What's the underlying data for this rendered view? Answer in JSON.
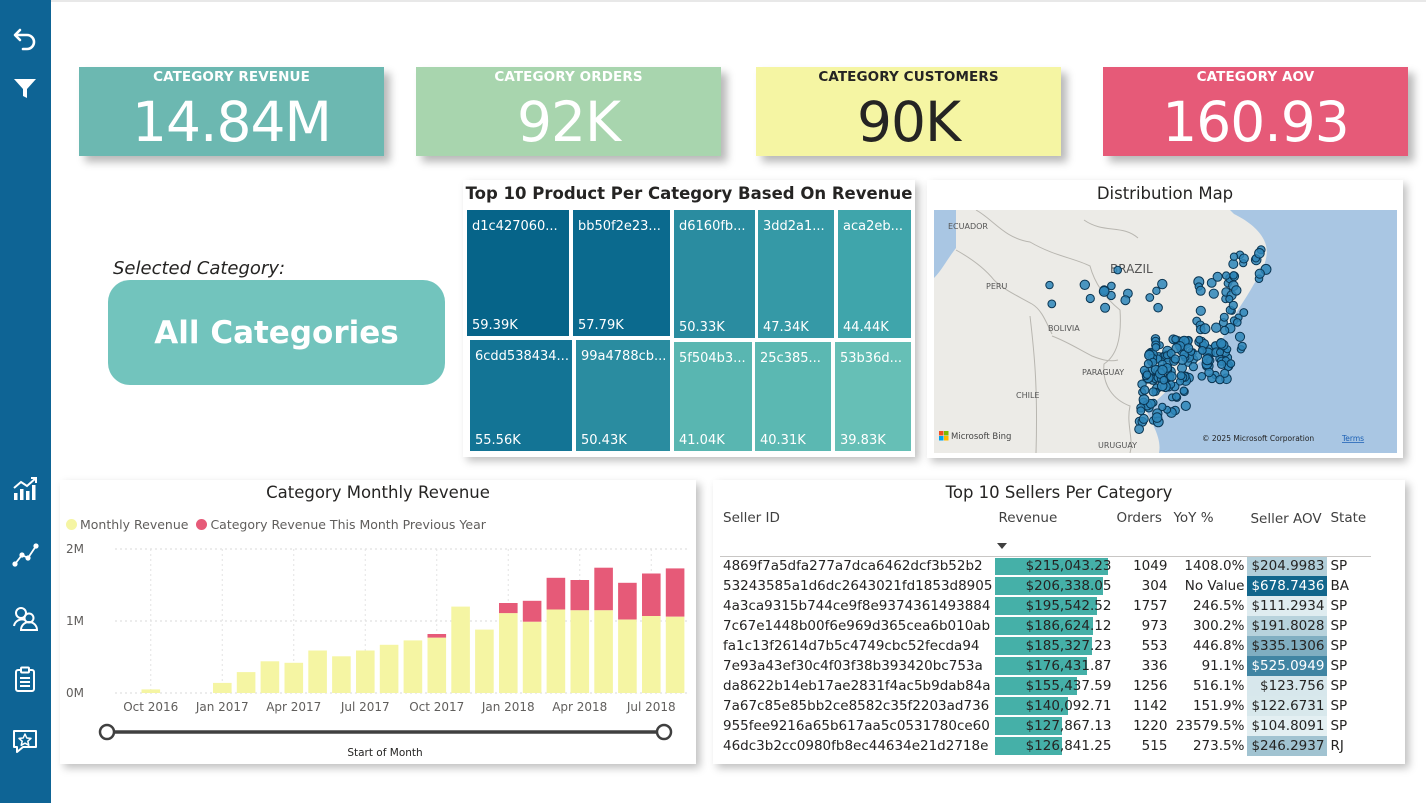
{
  "sidebar": {
    "items": [
      {
        "icon": "back-arrow-icon"
      },
      {
        "icon": "filter-icon"
      },
      {
        "icon": "bar-chart-icon"
      },
      {
        "icon": "line-chart-icon"
      },
      {
        "icon": "people-icon"
      },
      {
        "icon": "clipboard-icon"
      },
      {
        "icon": "review-star-icon"
      }
    ]
  },
  "kpis": [
    {
      "title": "CATEGORY REVENUE",
      "value": "14.84M",
      "bg": "#6cb8b1",
      "fg": "#ffffff"
    },
    {
      "title": "CATEGORY ORDERS",
      "value": "92K",
      "bg": "#a8d5ae",
      "fg": "#ffffff"
    },
    {
      "title": "CATEGORY CUSTOMERS",
      "value": "90K",
      "bg": "#f5f5a3",
      "fg": "#252423"
    },
    {
      "title": "CATEGORY AOV",
      "value": "160.93",
      "bg": "#e65a78",
      "fg": "#ffffff"
    }
  ],
  "selection": {
    "label": "Selected Category:",
    "value": "All Categories"
  },
  "treemap": {
    "title": "Top 10 Product Per Category Based On Revenue",
    "tiles": [
      {
        "name": "d1c427060...",
        "value": "59.39K",
        "color": "#066489"
      },
      {
        "name": "bb50f2e23...",
        "value": "57.79K",
        "color": "#0b6a8e"
      },
      {
        "name": "6cdd538434...",
        "value": "55.56K",
        "color": "#137495"
      },
      {
        "name": "99a4788cb...",
        "value": "50.43K",
        "color": "#2a8ca0"
      },
      {
        "name": "d6160fb...",
        "value": "50.33K",
        "color": "#2a8ca0"
      },
      {
        "name": "3dd2a1...",
        "value": "47.34K",
        "color": "#3599a6"
      },
      {
        "name": "aca2eb...",
        "value": "44.44K",
        "color": "#3fa5ab"
      },
      {
        "name": "5f504b3...",
        "value": "41.04K",
        "color": "#59b6b1"
      },
      {
        "name": "25c385...",
        "value": "40.31K",
        "color": "#5bb8b2"
      },
      {
        "name": "53b36d...",
        "value": "39.83K",
        "color": "#66bfb6"
      }
    ]
  },
  "map": {
    "title": "Distribution Map",
    "labels": {
      "ecuador": "ECUADOR",
      "brazil": "BRAZIL",
      "peru": "PERU",
      "bolivia": "BOLIVIA",
      "paraguay": "PARAGUAY",
      "chile": "CHILE",
      "uruguay": "URUGUAY"
    },
    "provider": "Microsoft Bing",
    "copyright": "© 2025 Microsoft Corporation",
    "terms": "Terms"
  },
  "monthly_chart": {
    "title": "Category Monthly Revenue",
    "legend": [
      {
        "name": "Monthly Revenue",
        "color": "#f5f5a3"
      },
      {
        "name": "Category Revenue This Month Previous Year",
        "color": "#e65a78"
      }
    ],
    "slider_label": "Start of Month"
  },
  "chart_data": {
    "type": "bar",
    "title": "Category Monthly Revenue",
    "xlabel": "",
    "ylabel": "",
    "ylim": [
      0,
      2000000
    ],
    "y_ticks": [
      "0M",
      "1M",
      "2M"
    ],
    "x_ticks": [
      "Oct 2016",
      "Jan 2017",
      "Apr 2017",
      "Jul 2017",
      "Oct 2017",
      "Jan 2018",
      "Apr 2018",
      "Jul 2018"
    ],
    "categories": [
      "Sep 2016",
      "Oct 2016",
      "Nov 2016",
      "Dec 2016",
      "Jan 2017",
      "Feb 2017",
      "Mar 2017",
      "Apr 2017",
      "May 2017",
      "Jun 2017",
      "Jul 2017",
      "Aug 2017",
      "Sep 2017",
      "Oct 2017",
      "Nov 2017",
      "Dec 2017",
      "Jan 2018",
      "Feb 2018",
      "Mar 2018",
      "Apr 2018",
      "May 2018",
      "Jun 2018",
      "Jul 2018",
      "Aug 2018"
    ],
    "series": [
      {
        "name": "Monthly Revenue",
        "values": [
          0,
          50000,
          0,
          0,
          140000,
          290000,
          440000,
          420000,
          590000,
          510000,
          590000,
          670000,
          730000,
          770000,
          1200000,
          880000,
          1110000,
          990000,
          1160000,
          1150000,
          1150000,
          1020000,
          1070000,
          1060000
        ]
      },
      {
        "name": "Category Revenue This Month Previous Year",
        "values": [
          0,
          0,
          0,
          0,
          0,
          0,
          0,
          0,
          0,
          0,
          0,
          0,
          0,
          50000,
          0,
          0,
          140000,
          290000,
          440000,
          420000,
          590000,
          510000,
          590000,
          670000
        ]
      }
    ]
  },
  "sellers_table": {
    "title": "Top 10 Sellers Per Category",
    "headers": {
      "seller": "Seller ID",
      "revenue": "Revenue",
      "orders": "Orders",
      "yoy": "YoY %",
      "aov": "Seller AOV",
      "state": "State"
    },
    "revenue_max": 215043.23,
    "aov_max": 678.7436,
    "rows": [
      {
        "seller": "4869f7a5dfa277a7dca6462dcf3b52b2",
        "revenue": "$215,043.23",
        "rev_num": 215043.23,
        "orders": "1049",
        "yoy": "1408.0%",
        "aov": "$204.9983",
        "aov_num": 204.9983,
        "state": "SP"
      },
      {
        "seller": "53243585a1d6dc2643021fd1853d8905",
        "revenue": "$206,338.05",
        "rev_num": 206338.05,
        "orders": "304",
        "yoy": "No Value",
        "aov": "$678.7436",
        "aov_num": 678.7436,
        "state": "BA"
      },
      {
        "seller": "4a3ca9315b744ce9f8e9374361493884",
        "revenue": "$195,542.52",
        "rev_num": 195542.52,
        "orders": "1757",
        "yoy": "246.5%",
        "aov": "$111.2934",
        "aov_num": 111.2934,
        "state": "SP"
      },
      {
        "seller": "7c67e1448b00f6e969d365cea6b010ab",
        "revenue": "$186,624.12",
        "rev_num": 186624.12,
        "orders": "973",
        "yoy": "300.2%",
        "aov": "$191.8028",
        "aov_num": 191.8028,
        "state": "SP"
      },
      {
        "seller": "fa1c13f2614d7b5c4749cbc52fecda94",
        "revenue": "$185,327.23",
        "rev_num": 185327.23,
        "orders": "553",
        "yoy": "446.8%",
        "aov": "$335.1306",
        "aov_num": 335.1306,
        "state": "SP"
      },
      {
        "seller": "7e93a43ef30c4f03f38b393420bc753a",
        "revenue": "$176,431.87",
        "rev_num": 176431.87,
        "orders": "336",
        "yoy": "91.1%",
        "aov": "$525.0949",
        "aov_num": 525.0949,
        "state": "SP"
      },
      {
        "seller": "da8622b14eb17ae2831f4ac5b9dab84a",
        "revenue": "$155,437.59",
        "rev_num": 155437.59,
        "orders": "1256",
        "yoy": "516.1%",
        "aov": "$123.756",
        "aov_num": 123.756,
        "state": "SP"
      },
      {
        "seller": "7a67c85e85bb2ce8582c35f2203ad736",
        "revenue": "$140,092.71",
        "rev_num": 140092.71,
        "orders": "1142",
        "yoy": "151.9%",
        "aov": "$122.6731",
        "aov_num": 122.6731,
        "state": "SP"
      },
      {
        "seller": "955fee9216a65b617aa5c0531780ce60",
        "revenue": "$127,867.13",
        "rev_num": 127867.13,
        "orders": "1220",
        "yoy": "23579.5%",
        "aov": "$104.8091",
        "aov_num": 104.8091,
        "state": "SP"
      },
      {
        "seller": "46dc3b2cc0980fb8ec44634e21d2718e",
        "revenue": "$126,841.25",
        "rev_num": 126841.25,
        "orders": "515",
        "yoy": "273.5%",
        "aov": "$246.2937",
        "aov_num": 246.2937,
        "state": "RJ"
      }
    ]
  }
}
